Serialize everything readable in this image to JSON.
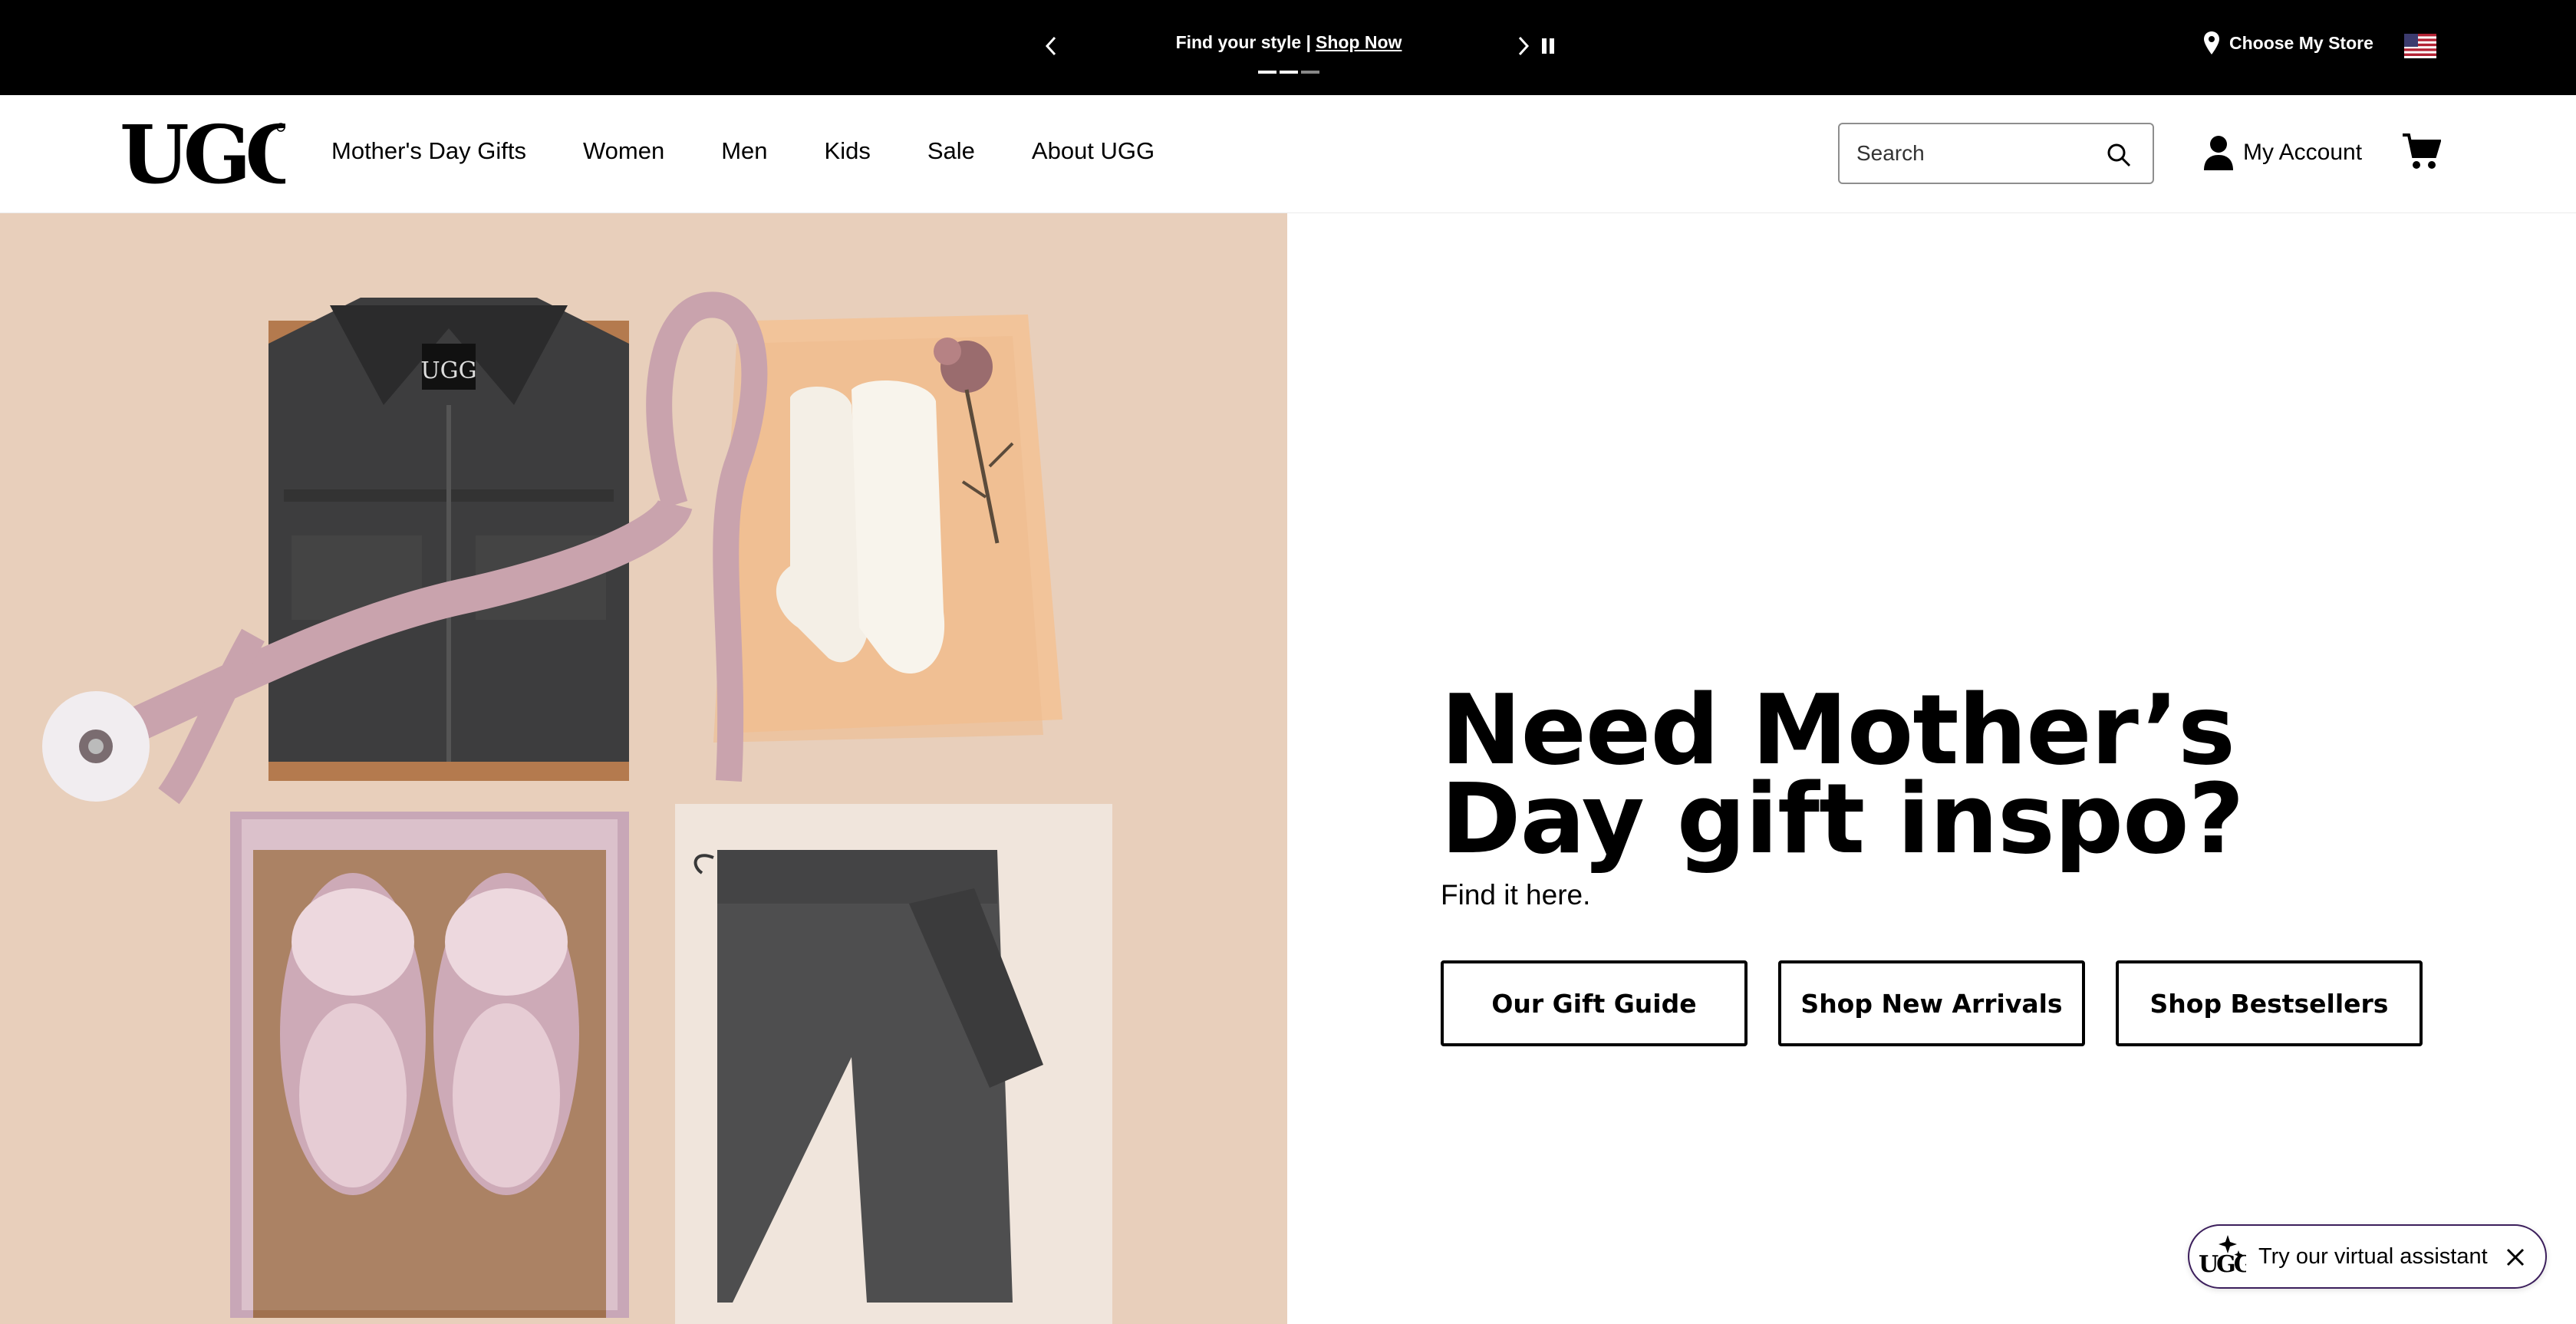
{
  "promo": {
    "message": "Find your style",
    "separator": "|",
    "link_label": "Shop Now",
    "active_slide": 2,
    "slide_count": 3,
    "prev_icon": "chevron-left-icon",
    "next_icon": "chevron-right-icon",
    "pause_icon": "pause-icon"
  },
  "store": {
    "label": "Choose My Store",
    "icon": "location-pin-icon"
  },
  "locale_flag": "us-flag-icon",
  "header": {
    "logo_text": "UGG",
    "nav": [
      {
        "label": "Mother's Day Gifts"
      },
      {
        "label": "Women"
      },
      {
        "label": "Men"
      },
      {
        "label": "Kids"
      },
      {
        "label": "Sale"
      },
      {
        "label": "About UGG"
      }
    ],
    "search": {
      "placeholder": "Search",
      "icon": "search-icon"
    },
    "account_label": "My Account",
    "account_icon": "user-icon",
    "cart_icon": "cart-icon"
  },
  "hero": {
    "headline_line1": "Need Mother’s",
    "headline_line2": "Day gift inspo?",
    "subline": "Find it here.",
    "buttons": [
      {
        "label": "Our Gift Guide"
      },
      {
        "label": "Shop New Arrivals"
      },
      {
        "label": "Shop Bestsellers"
      }
    ],
    "image_alt": "Flat lay of a black UGG jacket, pink satin ribbon, white socks, dried flower, pink sheepskin slippers and black shorts",
    "image_label": "UGG"
  },
  "assistant": {
    "label": "Try our virtual assistant",
    "logo_text": "UGG",
    "close_icon": "close-icon"
  },
  "colors": {
    "promo_bg": "#000000",
    "hero_bg": "#e7cdb8",
    "assistant_border": "#3c1f5c",
    "text": "#000000"
  }
}
